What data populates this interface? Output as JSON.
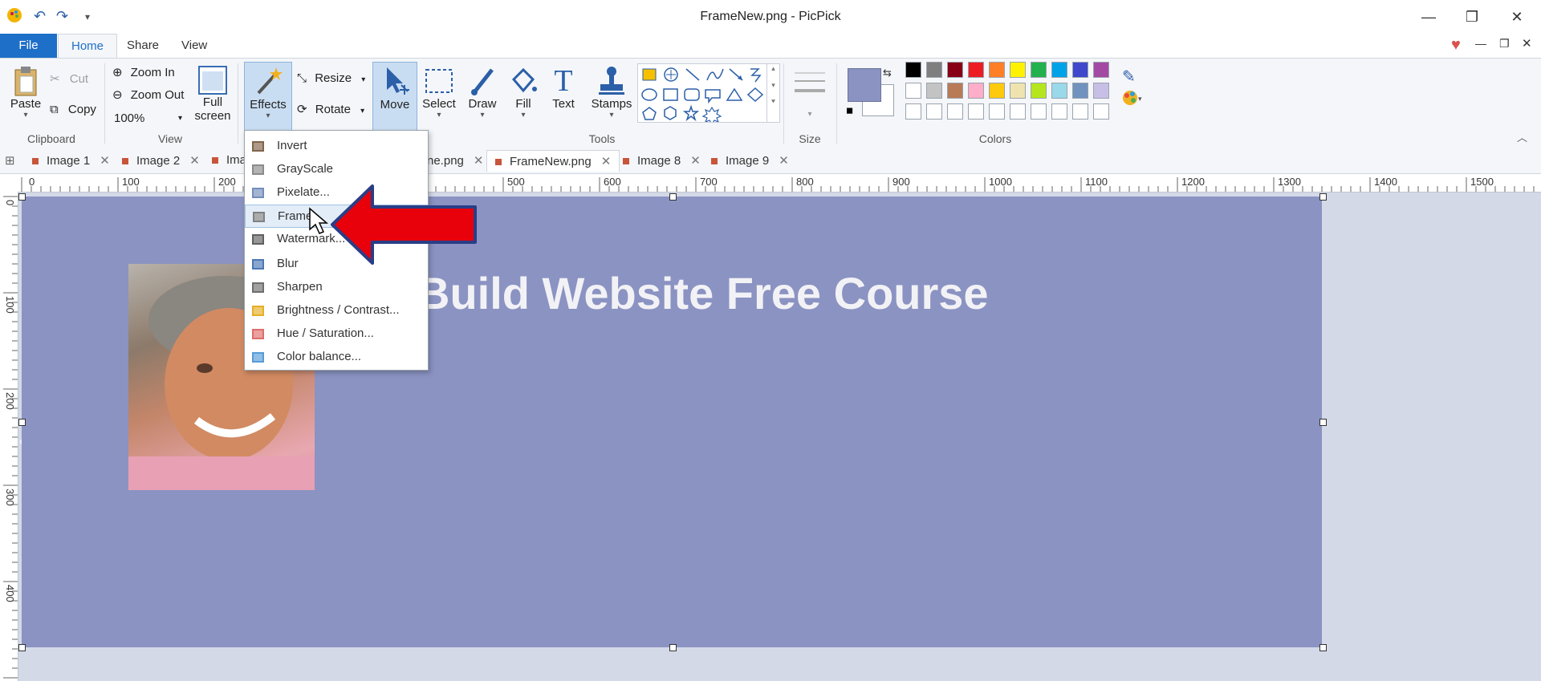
{
  "window": {
    "title": "FrameNew.png - PicPick",
    "minimize": "—",
    "restore": "❐",
    "close": "✕"
  },
  "menu": {
    "file": "File",
    "tabs": [
      "Home",
      "Share",
      "View"
    ]
  },
  "ribbon": {
    "clipboard": {
      "paste": "Paste",
      "cut": "Cut",
      "copy": "Copy",
      "label": "Clipboard"
    },
    "view": {
      "zoom_in": "Zoom In",
      "zoom_out": "Zoom Out",
      "zoom_value": "100%",
      "full_screen_1": "Full",
      "full_screen_2": "screen",
      "label": "View"
    },
    "effects": {
      "effects": "Effects",
      "resize": "Resize",
      "rotate": "Rotate"
    },
    "tools": {
      "move": "Move",
      "select": "Select",
      "draw": "Draw",
      "fill": "Fill",
      "text": "Text",
      "stamps": "Stamps",
      "label": "Tools"
    },
    "size": {
      "label": "Size"
    },
    "colors": {
      "label": "Colors",
      "primary": "#8b93c2",
      "palette_row1": [
        "#000000",
        "#7f7f7f",
        "#880015",
        "#ed1c24",
        "#ff7f27",
        "#fff200",
        "#22b14c",
        "#00a2e8",
        "#3f48cc",
        "#a349a4"
      ],
      "palette_row2": [
        "#ffffff",
        "#c3c3c3",
        "#b97a57",
        "#ffaec9",
        "#ffc90e",
        "#efe4b0",
        "#b5e61d",
        "#99d9ea",
        "#7092be",
        "#c8bfe7"
      ]
    }
  },
  "doc_tabs": [
    {
      "label": "Image 1"
    },
    {
      "label": "Image 2"
    },
    {
      "label": "Ima"
    },
    {
      "label": "ne.png"
    },
    {
      "label": "FrameNew.png"
    },
    {
      "label": "Image 8"
    },
    {
      "label": "Image 9"
    }
  ],
  "ruler_h": [
    "0",
    "100",
    "200",
    "500",
    "600",
    "700",
    "800",
    "900",
    "1000",
    "1100",
    "1200",
    "1300",
    "1400",
    "1500"
  ],
  "ruler_v": [
    "0",
    "100",
    "200",
    "300",
    "400"
  ],
  "canvas": {
    "headline": "Build Website Free Course"
  },
  "effects_menu": [
    {
      "label": "Invert",
      "icon": "invert-icon"
    },
    {
      "label": "GrayScale",
      "icon": "grayscale-icon"
    },
    {
      "label": "Pixelate...",
      "icon": "pixelate-icon"
    },
    {
      "label": "Frame...",
      "icon": "frame-icon"
    },
    {
      "label": "Watermark...",
      "icon": "watermark-icon"
    },
    {
      "label": "Blur",
      "icon": "blur-icon"
    },
    {
      "label": "Sharpen",
      "icon": "sharpen-icon"
    },
    {
      "label": "Brightness / Contrast...",
      "icon": "brightness-icon"
    },
    {
      "label": "Hue / Saturation...",
      "icon": "hue-icon"
    },
    {
      "label": "Color balance...",
      "icon": "color-balance-icon"
    }
  ]
}
